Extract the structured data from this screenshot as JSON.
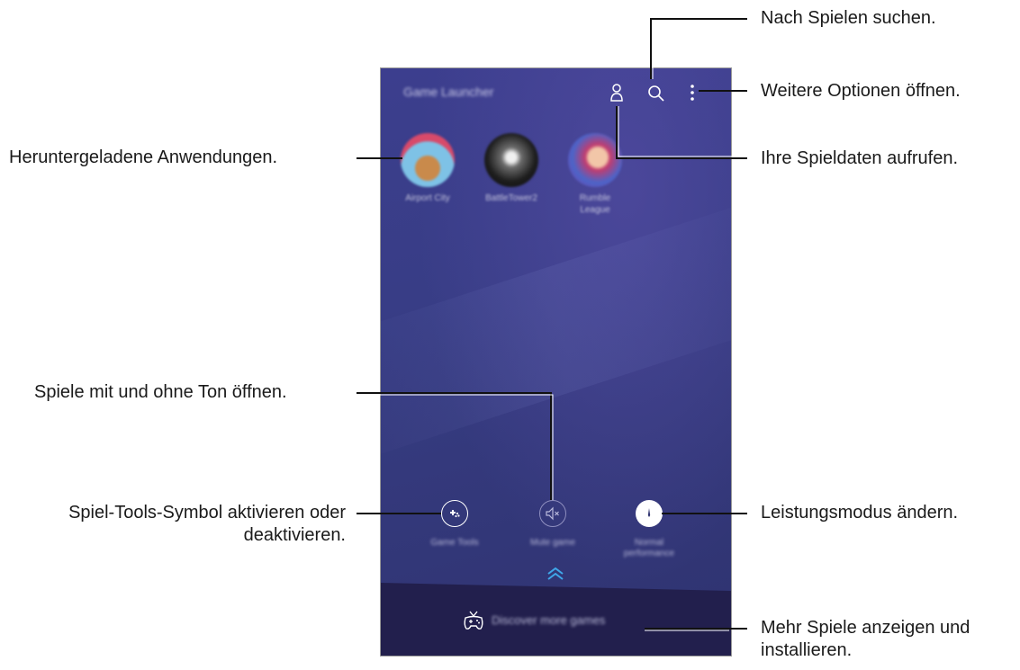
{
  "phone": {
    "app_title": "Game Launcher",
    "games": [
      {
        "name": "Airport City"
      },
      {
        "name": "BattleTower2"
      },
      {
        "name": "Rumble League"
      }
    ],
    "tools": [
      {
        "label": "Game Tools",
        "icon": "game-tools-icon"
      },
      {
        "label": "Mute game",
        "icon": "mute-icon"
      },
      {
        "label": "Normal performance",
        "icon": "performance-gauge-icon"
      }
    ],
    "discover_label": "Discover more games",
    "top_icons": [
      "profile-icon",
      "search-icon",
      "more-options-icon"
    ]
  },
  "callouts": {
    "search": "Nach Spielen suchen.",
    "more_options": "Weitere Optionen öffnen.",
    "downloaded_apps": "Heruntergeladene Anwendungen.",
    "profile": "Ihre Spieldaten aufrufen.",
    "mute": "Spiele mit und ohne Ton öffnen.",
    "game_tools_line1": "Spiel-Tools-Symbol aktivieren oder",
    "game_tools_line2": "deaktivieren.",
    "performance": "Leistungsmodus ändern.",
    "discover_line1": "Mehr Spiele anzeigen und",
    "discover_line2": "installieren."
  },
  "colors": {
    "background_top": "#3c3e8e",
    "background_bottom": "#2f3370",
    "bottom_band": "#221f4d",
    "accent_chevron": "#3fa6e8",
    "callout_line": "#111111"
  }
}
